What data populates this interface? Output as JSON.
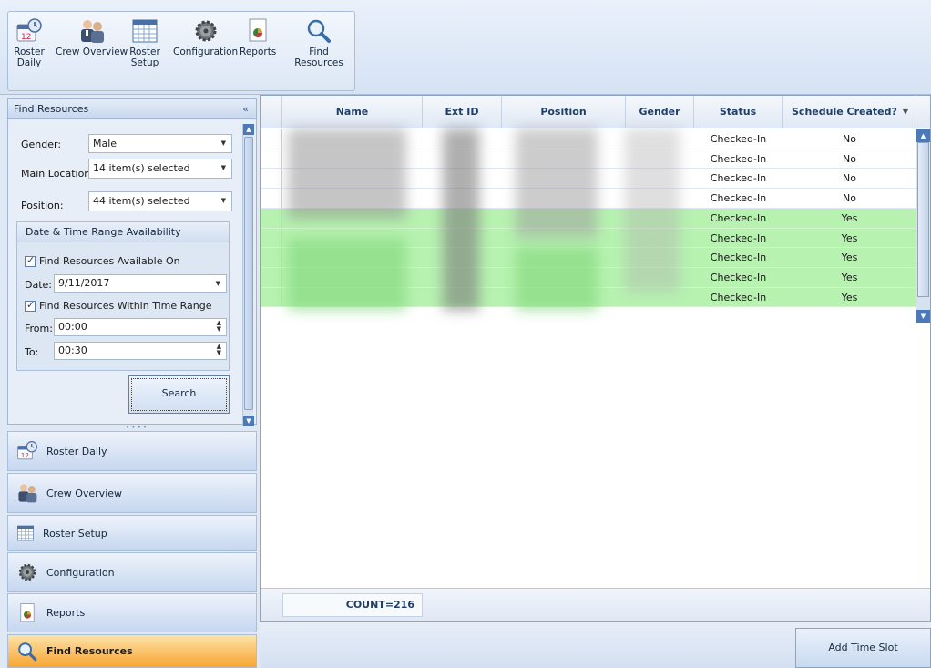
{
  "ribbon": {
    "buttons": [
      {
        "label": "Roster Daily",
        "icon": "calendar-clock-icon"
      },
      {
        "label": "Crew Overview",
        "icon": "crew-people-icon"
      },
      {
        "label": "Roster Setup",
        "icon": "grid-table-icon"
      },
      {
        "label": "Configuration",
        "icon": "gear-icon"
      },
      {
        "label": "Reports",
        "icon": "report-chart-icon"
      },
      {
        "label": "Find Resources",
        "icon": "magnifier-icon"
      }
    ]
  },
  "panel": {
    "title": "Find Resources",
    "collapse": "«",
    "gender_label": "Gender:",
    "gender_value": "Male",
    "main_location_label": "Main Location:",
    "main_location_value": "14 item(s) selected",
    "position_label": "Position:",
    "position_value": "44 item(s) selected",
    "dt_group_title": "Date & Time Range Availability",
    "available_on_label": "Find Resources Available On",
    "date_label": "Date:",
    "date_value": "9/11/2017",
    "within_range_label": "Find Resources Within Time Range",
    "from_label": "From:",
    "from_value": "00:00",
    "to_label": "To:",
    "to_value": "00:30",
    "search_label": "Search"
  },
  "nav": [
    {
      "label": "Roster Daily",
      "icon": "calendar-clock-icon"
    },
    {
      "label": "Crew Overview",
      "icon": "crew-people-icon"
    },
    {
      "label": "Roster Setup",
      "icon": "grid-table-icon"
    },
    {
      "label": "Configuration",
      "icon": "gear-icon"
    },
    {
      "label": "Reports",
      "icon": "report-chart-icon"
    },
    {
      "label": "Find Resources",
      "icon": "magnifier-icon",
      "active": true
    }
  ],
  "grid": {
    "columns": [
      "Name",
      "Ext ID",
      "Position",
      "Gender",
      "Status",
      "Schedule Created?"
    ],
    "rows": [
      {
        "status": "Checked-In",
        "schedule": "No",
        "green": false
      },
      {
        "status": "Checked-In",
        "schedule": "No",
        "green": false
      },
      {
        "status": "Checked-In",
        "schedule": "No",
        "green": false
      },
      {
        "status": "Checked-In",
        "schedule": "No",
        "green": false
      },
      {
        "status": "Checked-In",
        "schedule": "Yes",
        "green": true
      },
      {
        "status": "Checked-In",
        "schedule": "Yes",
        "green": true
      },
      {
        "status": "Checked-In",
        "schedule": "Yes",
        "green": true
      },
      {
        "status": "Checked-In",
        "schedule": "Yes",
        "green": true
      },
      {
        "status": "Checked-In",
        "schedule": "Yes",
        "green": true
      }
    ],
    "count": "COUNT=216"
  },
  "actions": {
    "add_time_slot": "Add Time Slot"
  },
  "colors": {
    "accent": "#f7a533",
    "row_green": "#b7f2b0",
    "header_text": "#1f3f66"
  }
}
